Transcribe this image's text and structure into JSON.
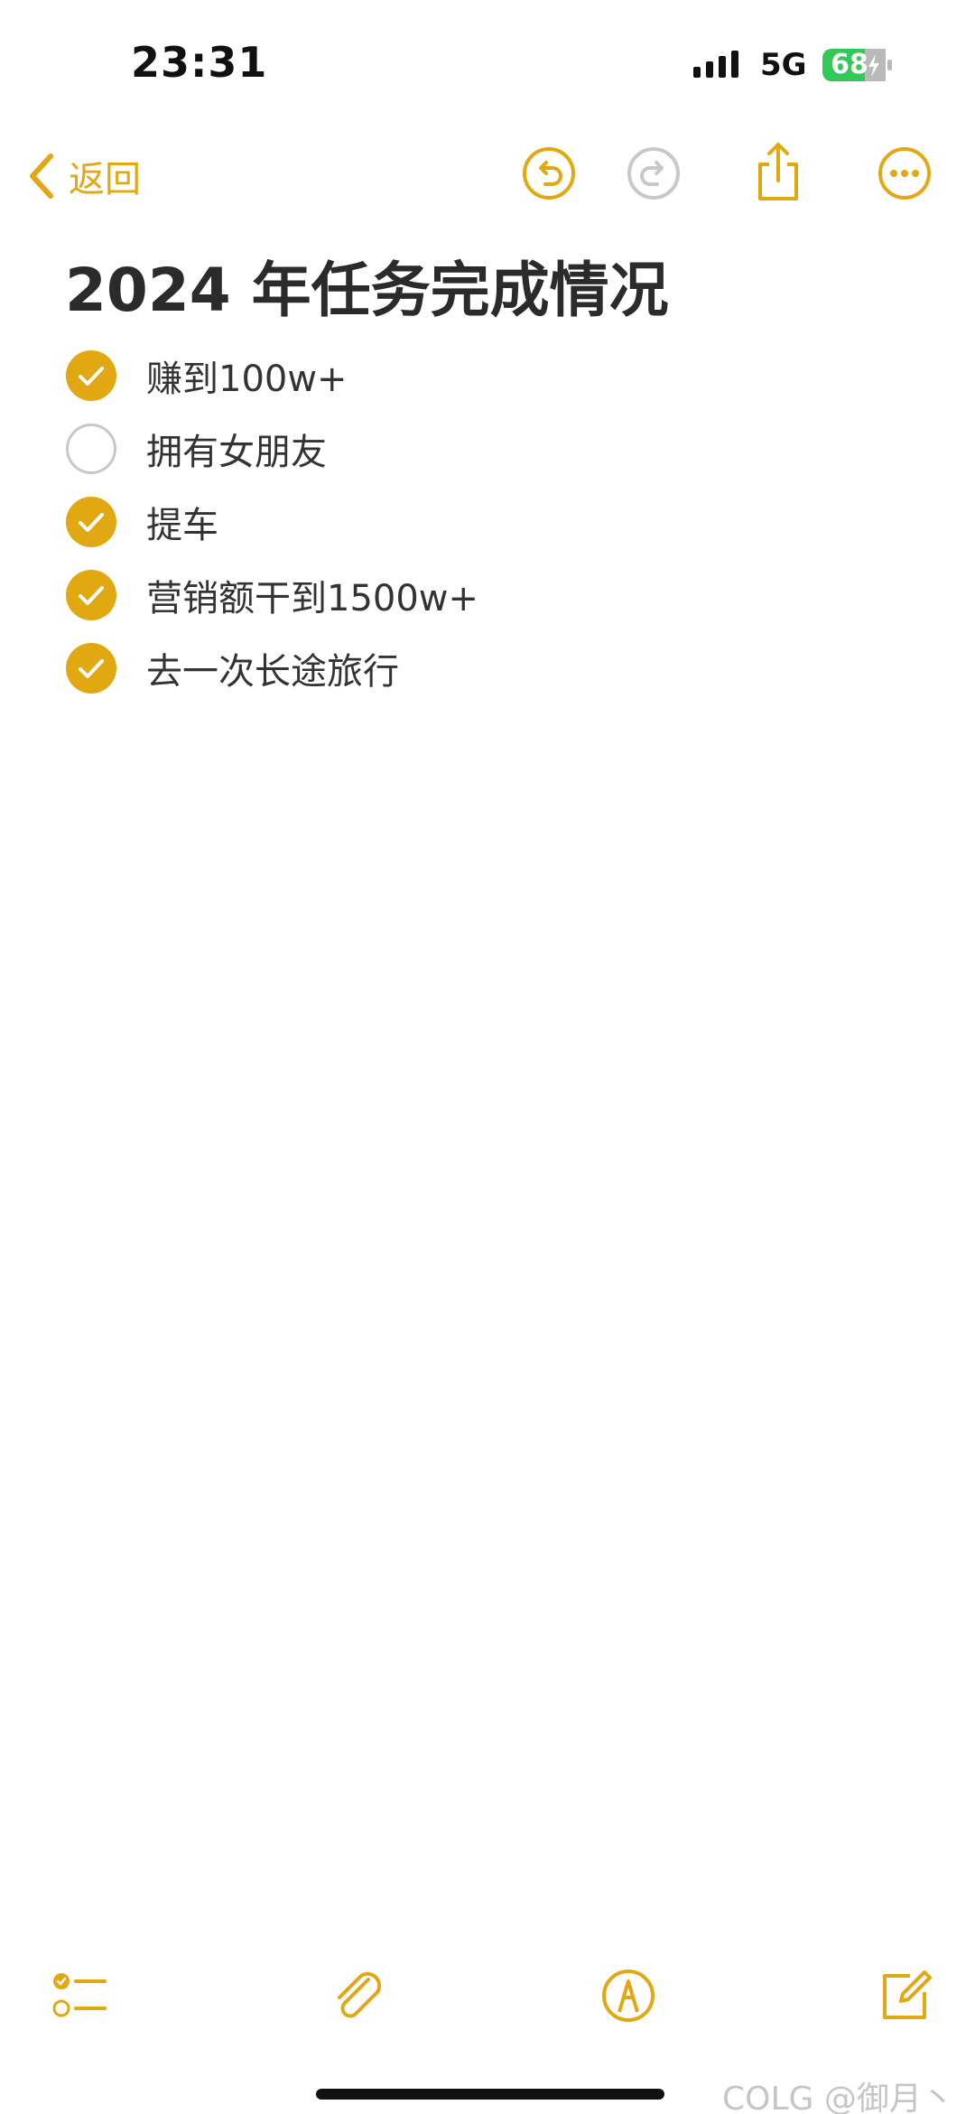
{
  "status_bar": {
    "time": "23:31",
    "network": "5G",
    "battery": "68"
  },
  "nav": {
    "back_label": "返回"
  },
  "note": {
    "title": "2024 年任务完成情况",
    "items": [
      {
        "text": "赚到100w+",
        "checked": true
      },
      {
        "text": "拥有女朋友",
        "checked": false
      },
      {
        "text": "提车",
        "checked": true
      },
      {
        "text": "营销额干到1500w+",
        "checked": true
      },
      {
        "text": "去一次长途旅行",
        "checked": true
      }
    ]
  },
  "watermark": "COLG @御月丶",
  "colors": {
    "accent": "#e2a812",
    "disabled": "#c8c8c8",
    "battery": "#34c759"
  }
}
